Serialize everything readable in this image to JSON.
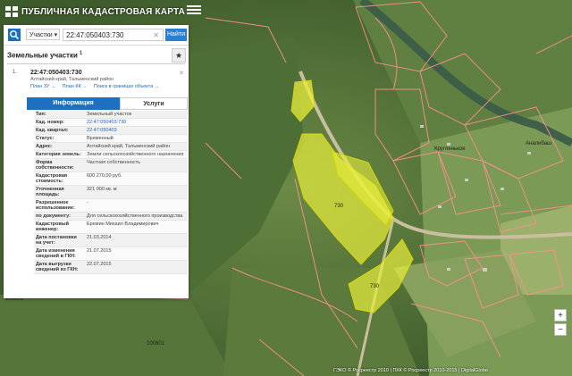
{
  "header": {
    "title": "ПУБЛИЧНАЯ КАДАСТРОВАЯ КАРТА"
  },
  "search": {
    "type_label": "Участки",
    "value": "22:47:050403:730",
    "button_label": "Найти"
  },
  "section": {
    "title": "Земельные участки",
    "count": "1"
  },
  "result": {
    "index": "1.",
    "cad_number": "22:47:050403:730",
    "address_short": "Алтайский край, Тальменский район",
    "links": [
      "План ЗУ →",
      "План КК →",
      "Поиск в границах объекта →"
    ]
  },
  "tabs": [
    "Информация",
    "Услуги"
  ],
  "info_rows": [
    {
      "k": "Тип:",
      "v": "Земельный участок"
    },
    {
      "k": "Кад. номер:",
      "v": "22:47:050403:730"
    },
    {
      "k": "Кад. квартал:",
      "v": "22:47:050403"
    },
    {
      "k": "Статус:",
      "v": "Временный"
    },
    {
      "k": "Адрес:",
      "v": "Алтайский край, Тальменский район"
    },
    {
      "k": "Категория земель:",
      "v": "Земли сельскохозяйственного назначения"
    },
    {
      "k": "Форма собственности:",
      "v": "Частная собственность"
    },
    {
      "k": "Кадастровая стоимость:",
      "v": "600 270,00 руб."
    },
    {
      "k": "Уточненная площадь:",
      "v": "321 000 кв. м"
    },
    {
      "k": "Разрешенное использование:",
      "v": "-"
    },
    {
      "k": "по документу:",
      "v": "Для сельскохозяйственного производства"
    },
    {
      "k": "Кадастровый инженер:",
      "v": "Еремин Михаил Владимирович"
    },
    {
      "k": "Дата постановки на учет:",
      "v": "21.03.2014"
    },
    {
      "k": "Дата изменения сведений в ГКН:",
      "v": "21.07.2015"
    },
    {
      "k": "Дата выгрузки сведений из ГКН:",
      "v": "22.07.2015"
    }
  ],
  "map_labels": {
    "parcel_a": "730",
    "parcel_b": "730",
    "district_1": "Кругленькое",
    "district_2": "Аналибаш",
    "left_edge": "100001",
    "bottom": "100601"
  },
  "zoom": {
    "in": "+",
    "out": "−"
  },
  "attribution": "ГЭКО © Росреестр 2010 | ПКК © Росреестр 2010-2015 | DigitalGlobe",
  "colors": {
    "accent": "#1d6fbf",
    "parcel_fill": "#e8ee3c",
    "boundary": "#ff8a8a"
  }
}
